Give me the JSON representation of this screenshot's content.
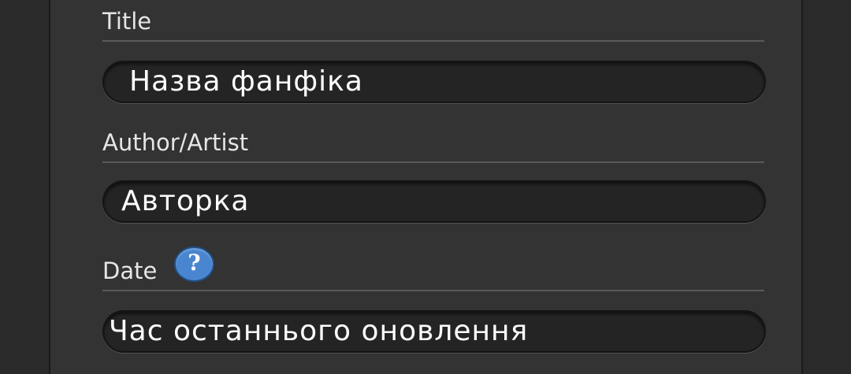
{
  "form": {
    "title": {
      "label": "Title",
      "value": "Назва фанфіка"
    },
    "author": {
      "label": "Author/Artist",
      "value": "Авторка"
    },
    "date": {
      "label": "Date",
      "help_icon": "?",
      "value": "Час останнього оновлення"
    }
  },
  "colors": {
    "background": "#333333",
    "input_background": "#242424",
    "help_icon": "#4a86cf",
    "label_text": "#e6e6e6",
    "input_text": "#ffffff"
  },
  "icons": {
    "help": "help-icon"
  }
}
